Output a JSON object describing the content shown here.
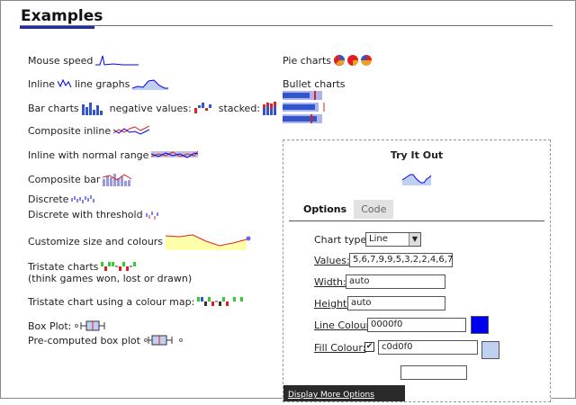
{
  "page": {
    "heading": "Examples"
  },
  "left": {
    "mouse_speed": "Mouse speed",
    "inline_line": "Inline",
    "inline_line_suffix": "line graphs",
    "bar_charts": "Bar charts",
    "negative_values": "negative values:",
    "stacked": "stacked:",
    "composite_inline": "Composite inline",
    "inline_normal_range": "Inline with normal range",
    "composite_bar": "Composite bar",
    "discrete": "Discrete",
    "discrete_threshold": "Discrete with threshold",
    "customize": "Customize size and colours",
    "tristate": "Tristate charts",
    "tristate_note": "(think games won, lost or drawn)",
    "tristate_colour_map": "Tristate chart using a colour map:",
    "box_plot": "Box Plot:",
    "precomputed_box": "Pre-computed box plot"
  },
  "right": {
    "pie_charts": "Pie charts",
    "bullet_charts": "Bullet charts"
  },
  "try_it_out": {
    "title": "Try It Out",
    "tabs": [
      {
        "label": "Options",
        "active": true
      },
      {
        "label": "Code",
        "active": false
      }
    ],
    "chart_type_label": "Chart type:",
    "chart_type_value": "Line",
    "values_label": "Values:",
    "values_value": "5,6,7,9,9,5,3,2,2,4,6,7",
    "width_label": "Width:",
    "width_value": "auto",
    "height_label": "Height:",
    "height_value": "auto",
    "line_colour_label": "Line Colour:",
    "line_colour_value": "0000f0",
    "fill_colour_label": "Fill Colour:",
    "fill_colour_value": "c0d0f0",
    "fill_checked": true,
    "more_options": "Display More Options"
  },
  "colors": {
    "line_blue": "#0000f0",
    "fill_blue": "#c0d0f0",
    "accent_red": "#e02020",
    "header_underline": "#1f2f9f"
  }
}
